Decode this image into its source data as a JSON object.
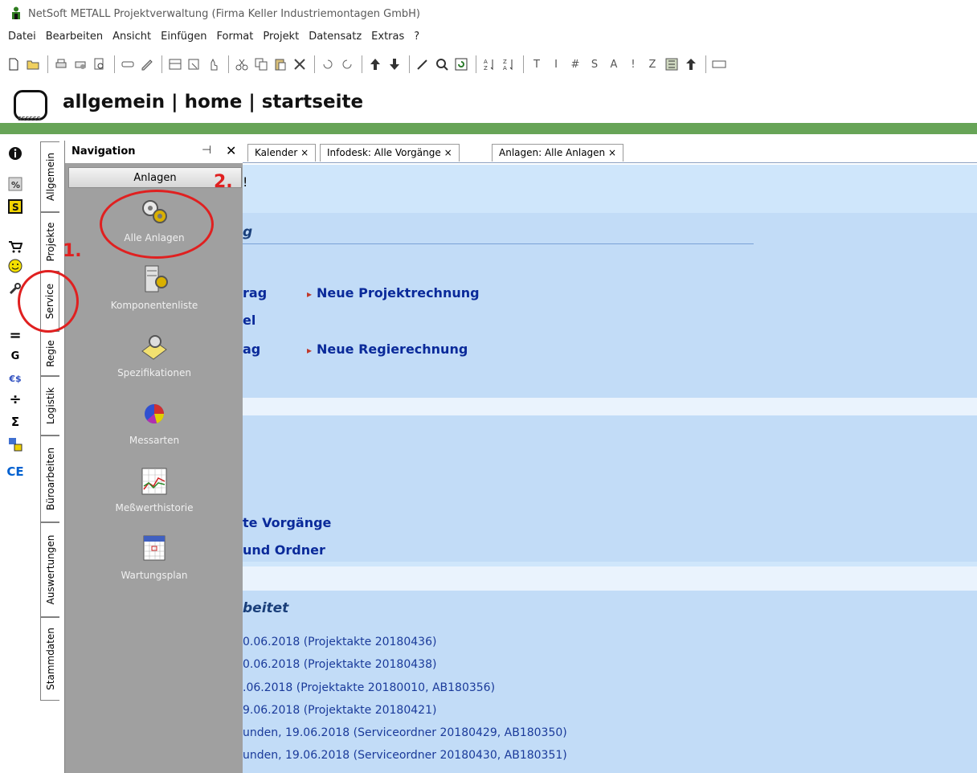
{
  "window": {
    "title": "NetSoft METALL Projektverwaltung (Firma Keller Industriemontagen GmbH)"
  },
  "menu": [
    "Datei",
    "Bearbeiten",
    "Ansicht",
    "Einfügen",
    "Format",
    "Projekt",
    "Datensatz",
    "Extras",
    "?"
  ],
  "toolbar": {
    "text_buttons": [
      "T",
      "I",
      "#",
      "S",
      "A",
      "!",
      "Z"
    ]
  },
  "header": {
    "logo_small": "SSSSSS",
    "heading": "allgemein | home | startseite"
  },
  "left_icons": {
    "g_label": "G",
    "ce_label": "CE",
    "euro_label": "€$",
    "div_label": "÷",
    "sum_label": "Σ",
    "eq_label": "="
  },
  "vertical_tabs": [
    "Allgemein",
    "Projekte",
    "Service",
    "Regie",
    "Logistik",
    "Büroarbeiten",
    "Auswertungen",
    "Stammdaten"
  ],
  "navigation": {
    "title": "Navigation",
    "pin": "⊣",
    "close": "✕",
    "section": "Anlagen",
    "items": [
      "Alle Anlagen",
      "Komponentenliste",
      "Spezifikationen",
      "Messarten",
      "Meßwerthistorie",
      "Wartungsplan"
    ]
  },
  "doc_tabs": [
    "Kalender ×",
    "Infodesk: Alle Vorgänge ×",
    "Anlagen: Alle Anlagen ×"
  ],
  "content": {
    "top_text": "!",
    "section1_title": "g",
    "link_rag": "rag",
    "link_neue_projektrechnung": "Neue Projektrechnung",
    "link_el": "el",
    "link_ag": "ag",
    "link_neue_regierechnung": "Neue Regierechnung",
    "link_vorgaenge": "te Vorgänge",
    "link_ordner": "und Ordner",
    "section3_title": "beitet",
    "recent": [
      "0.06.2018 (Projektakte 20180436)",
      "0.06.2018 (Projektakte 20180438)",
      ".06.2018 (Projektakte 20180010, AB180356)",
      "9.06.2018 (Projektakte 20180421)",
      "unden, 19.06.2018 (Serviceordner 20180429, AB180350)",
      "unden, 19.06.2018 (Serviceordner 20180430, AB180351)"
    ]
  },
  "annotations": {
    "one": "1.",
    "two": "2."
  },
  "colors": {
    "green_bar": "#67a457",
    "content_bg": "#cfe6fb",
    "link": "#0a2a9a",
    "annotation": "#e02020"
  }
}
